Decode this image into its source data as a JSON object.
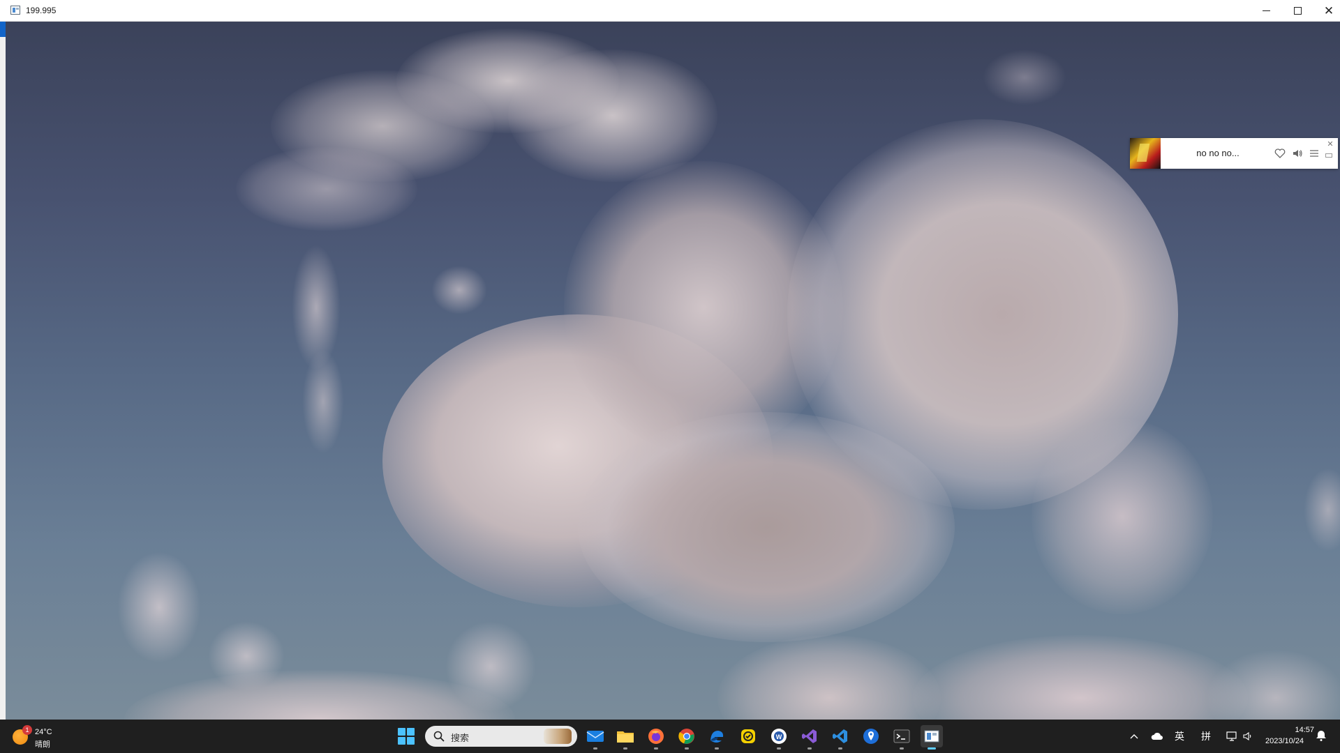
{
  "window": {
    "title": "199.995"
  },
  "music_player": {
    "track_title": "no no no...",
    "icons": [
      "heart-icon",
      "volume-icon",
      "playlist-icon",
      "close-icon"
    ]
  },
  "taskbar": {
    "weather": {
      "badge": "1",
      "temperature": "24°C",
      "condition": "晴朗"
    },
    "search": {
      "placeholder": "搜索"
    },
    "pinned_apps": [
      "mail-icon",
      "file-explorer-icon",
      "firefox-icon",
      "chrome-icon",
      "edge-dev-icon",
      "todo-app-icon",
      "word-app-icon",
      "visual-studio-icon",
      "vscode-icon",
      "maps-icon",
      "terminal-icon",
      "active-app-icon"
    ],
    "tray": {
      "ime_lang": "英",
      "ime_mode": "拼"
    },
    "clock": {
      "time": "14:57",
      "date": "2023/10/24"
    }
  }
}
